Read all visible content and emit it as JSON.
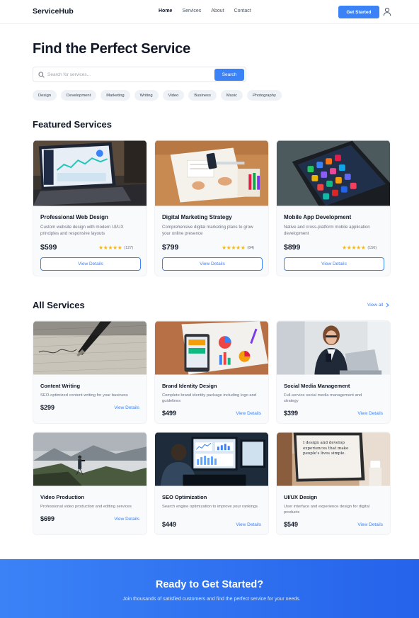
{
  "header": {
    "logo": "ServiceHub",
    "nav": [
      "Home",
      "Services",
      "About",
      "Contact"
    ],
    "cta_label": "Get Started"
  },
  "hero": {
    "title": "Find the Perfect Service",
    "search_placeholder": "Search for services...",
    "search_button": "Search",
    "categories": [
      "Design",
      "Development",
      "Marketing",
      "Writing",
      "Video",
      "Business",
      "Music",
      "Photography"
    ]
  },
  "featured": {
    "title": "Featured Services",
    "items": [
      {
        "title": "Professional Web Design",
        "description": "Custom website design with modern UI/UX principles and responsive layouts",
        "price": "$599",
        "rating": 4.5,
        "reviews": "(127)",
        "button": "View Details"
      },
      {
        "title": "Digital Marketing Strategy",
        "description": "Comprehensive digital marketing plans to grow your online presence",
        "price": "$799",
        "rating": 4.5,
        "reviews": "(84)",
        "button": "View Details"
      },
      {
        "title": "Mobile App Development",
        "description": "Native and cross-platform mobile application development",
        "price": "$899",
        "rating": 4.5,
        "reviews": "(156)",
        "button": "View Details"
      }
    ]
  },
  "all_services": {
    "title": "All Services",
    "view_all": "View all",
    "items": [
      {
        "title": "Content Writing",
        "description": "SEO-optimized content writing for your business",
        "price": "$299",
        "link": "View Details"
      },
      {
        "title": "Brand Identity Design",
        "description": "Complete brand identity package including logo and guidelines",
        "price": "$499",
        "link": "View Details"
      },
      {
        "title": "Social Media Management",
        "description": "Full-service social media management and strategy",
        "price": "$399",
        "link": "View Details"
      },
      {
        "title": "Video Production",
        "description": "Professional video production and editing services",
        "price": "$699",
        "link": "View Details"
      },
      {
        "title": "SEO Optimization",
        "description": "Search engine optimization to improve your rankings",
        "price": "$449",
        "link": "View Details"
      },
      {
        "title": "UI/UX Design",
        "description": "User interface and experience design for digital products",
        "price": "$549",
        "link": "View Details"
      }
    ],
    "uiux_image_text": "I design and develop experiences that make people's lives simple."
  },
  "cta": {
    "title": "Ready to Get Started?",
    "subtitle": "Join thousands of satisfied customers and find the perfect service for your needs."
  },
  "colors": {
    "accent": "#3b82f6",
    "star": "#f5b81a",
    "card_bg": "#f8fafc"
  }
}
